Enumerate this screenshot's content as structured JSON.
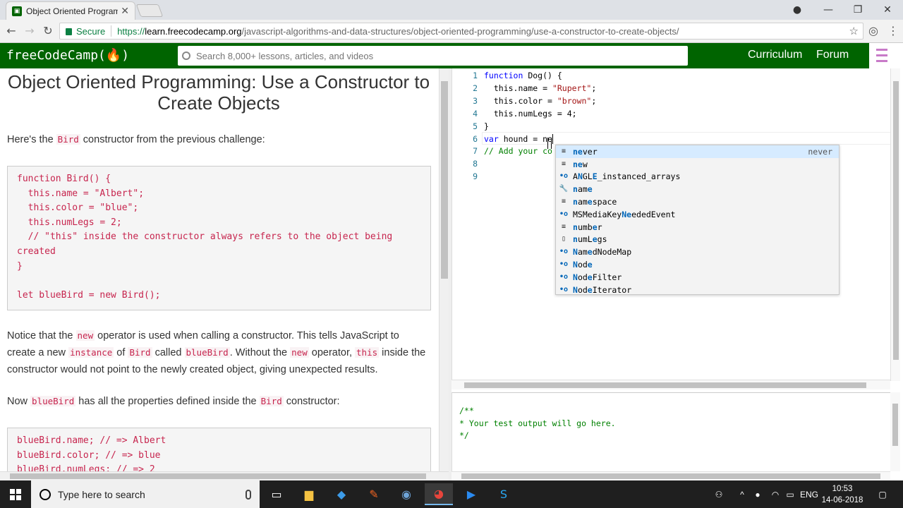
{
  "browser": {
    "tab_title": "Object Oriented Programm",
    "secure_label": "Secure",
    "url_scheme": "https://",
    "url_host": "learn.freecodecamp.org",
    "url_path": "/javascript-algorithms-and-data-structures/object-oriented-programming/use-a-constructor-to-create-objects/"
  },
  "fcc_nav": {
    "logo": "freeCodeCamp(🔥)",
    "search_placeholder": "Search 8,000+ lessons, articles, and videos",
    "curriculum": "Curriculum",
    "forum": "Forum"
  },
  "lesson": {
    "title": "Object Oriented Programming: Use a Constructor to Create Objects",
    "p1_a": "Here's the ",
    "p1_code": "Bird",
    "p1_b": " constructor from the previous challenge:",
    "code1": "function Bird() {\n  this.name = \"Albert\";\n  this.color = \"blue\";\n  this.numLegs = 2;\n  // \"this\" inside the constructor always refers to the object being created\n}\n\nlet blueBird = new Bird();",
    "p2_a": "Notice that the ",
    "p2_new": "new",
    "p2_b": " operator is used when calling a constructor. This tells JavaScript to create a new ",
    "p2_instance": "instance",
    "p2_c": " of ",
    "p2_bird": "Bird",
    "p2_d": " called ",
    "p2_bluebird": "blueBird",
    "p2_e": ". Without the ",
    "p2_new2": "new",
    "p2_f": " operator, ",
    "p2_this": "this",
    "p2_g": " inside the constructor would not point to the newly created object, giving unexpected results.",
    "p3_a": "Now ",
    "p3_bluebird": "blueBird",
    "p3_b": " has all the properties defined inside the ",
    "p3_bird": "Bird",
    "p3_c": " constructor:",
    "code2": "blueBird.name; // => Albert\nblueBird.color; // => blue\nblueBird.numLegs; // => 2"
  },
  "editor": {
    "line_numbers": [
      "1",
      "2",
      "3",
      "4",
      "5",
      "6",
      "7",
      "8",
      "9"
    ],
    "lines": [
      {
        "kw": "function",
        "rest": " Dog() {"
      },
      {
        "plain": "  this.name = ",
        "str": "\"Rupert\"",
        "tail": ";"
      },
      {
        "plain": "  this.color = ",
        "str": "\"brown\"",
        "tail": ";"
      },
      {
        "plain": "  this.numLegs = 4;"
      },
      {
        "plain": "}"
      },
      {
        "kw": "var",
        "rest": " hound = ne"
      },
      {
        "cmt": "// Add your co"
      },
      {
        "plain": ""
      },
      {
        "plain": ""
      }
    ]
  },
  "suggest": {
    "items": [
      {
        "icon": "keyword-icon",
        "glyph": "≡",
        "pre": "",
        "hl": "ne",
        "post": "ver",
        "detail": "never",
        "selected": true
      },
      {
        "icon": "keyword-icon",
        "glyph": "≡",
        "pre": "",
        "hl": "ne",
        "post": "w",
        "detail": ""
      },
      {
        "icon": "class-icon",
        "glyph": "•o",
        "pre": "A",
        "hl": "N",
        "post": "GL",
        "hl2": "E",
        "post2": "_instanced_arrays",
        "detail": ""
      },
      {
        "icon": "property-icon",
        "glyph": "🔧",
        "pre": "",
        "hl": "n",
        "post": "am",
        "hl2": "e",
        "post2": "",
        "detail": ""
      },
      {
        "icon": "keyword-icon",
        "glyph": "≡",
        "pre": "",
        "hl": "n",
        "post": "am",
        "hl2": "e",
        "post2": "space",
        "detail": ""
      },
      {
        "icon": "class-icon",
        "glyph": "•o",
        "pre": "MSMediaKey",
        "hl": "Ne",
        "post": "ededEvent",
        "detail": ""
      },
      {
        "icon": "keyword-icon",
        "glyph": "≡",
        "pre": "",
        "hl": "n",
        "post": "umb",
        "hl2": "e",
        "post2": "r",
        "detail": ""
      },
      {
        "icon": "file-icon",
        "glyph": "▯",
        "pre": "",
        "hl": "n",
        "post": "umL",
        "hl2": "e",
        "post2": "gs",
        "detail": ""
      },
      {
        "icon": "class-icon",
        "glyph": "•o",
        "pre": "",
        "hl": "N",
        "post": "am",
        "hl2": "e",
        "post2": "dNodeMap",
        "detail": ""
      },
      {
        "icon": "class-icon",
        "glyph": "•o",
        "pre": "",
        "hl": "N",
        "post": "od",
        "hl2": "e",
        "post2": "",
        "detail": ""
      },
      {
        "icon": "class-icon",
        "glyph": "•o",
        "pre": "",
        "hl": "N",
        "post": "od",
        "hl2": "e",
        "post2": "Filter",
        "detail": ""
      },
      {
        "icon": "class-icon",
        "glyph": "•o",
        "pre": "",
        "hl": "N",
        "post": "od",
        "hl2": "e",
        "post2": "Iterator",
        "detail": ""
      }
    ]
  },
  "output": {
    "lines": [
      "/**",
      "* Your test output will go here.",
      "*/"
    ]
  },
  "taskbar": {
    "search_placeholder": "Type here to search",
    "lang": "ENG",
    "time": "10:53",
    "date": "14-06-2018"
  }
}
